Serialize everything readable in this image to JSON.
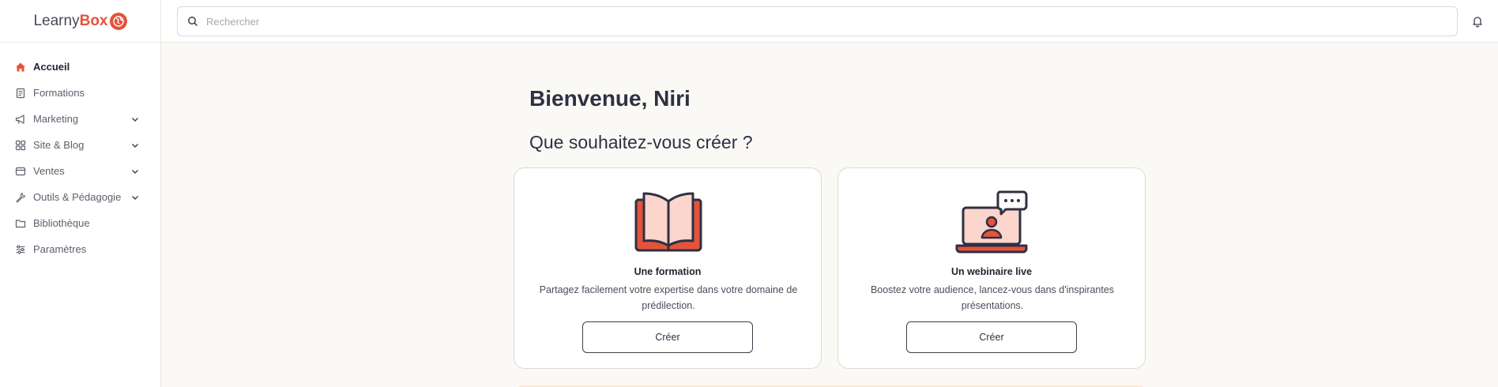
{
  "brand": {
    "part1": "Learny",
    "part2": "Box"
  },
  "search": {
    "placeholder": "Rechercher"
  },
  "sidebar": {
    "items": [
      {
        "label": "Accueil",
        "icon": "home-icon",
        "active": true,
        "expandable": false
      },
      {
        "label": "Formations",
        "icon": "book-icon",
        "expandable": false
      },
      {
        "label": "Marketing",
        "icon": "megaphone-icon",
        "expandable": true
      },
      {
        "label": "Site & Blog",
        "icon": "grid-icon",
        "expandable": true
      },
      {
        "label": "Ventes",
        "icon": "wallet-icon",
        "expandable": true
      },
      {
        "label": "Outils & Pédagogie",
        "icon": "wrench-icon",
        "expandable": true
      },
      {
        "label": "Bibliothèque",
        "icon": "folder-icon",
        "expandable": false
      },
      {
        "label": "Paramètres",
        "icon": "sliders-icon",
        "expandable": false
      }
    ]
  },
  "main": {
    "welcome": "Bienvenue, Niri",
    "question": "Que souhaitez-vous créer ?",
    "cards": [
      {
        "title": "Une formation",
        "description": "Partagez facilement votre expertise dans votre domaine de prédilection.",
        "button": "Créer",
        "icon": "open-book-icon"
      },
      {
        "title": "Un webinaire live",
        "description": "Boostez votre audience, lancez-vous dans d'inspirantes présentations.",
        "button": "Créer",
        "icon": "laptop-webinar-icon"
      }
    ]
  },
  "colors": {
    "accent": "#e5533b",
    "background": "#fbf9f6",
    "text": "#2d3142"
  }
}
